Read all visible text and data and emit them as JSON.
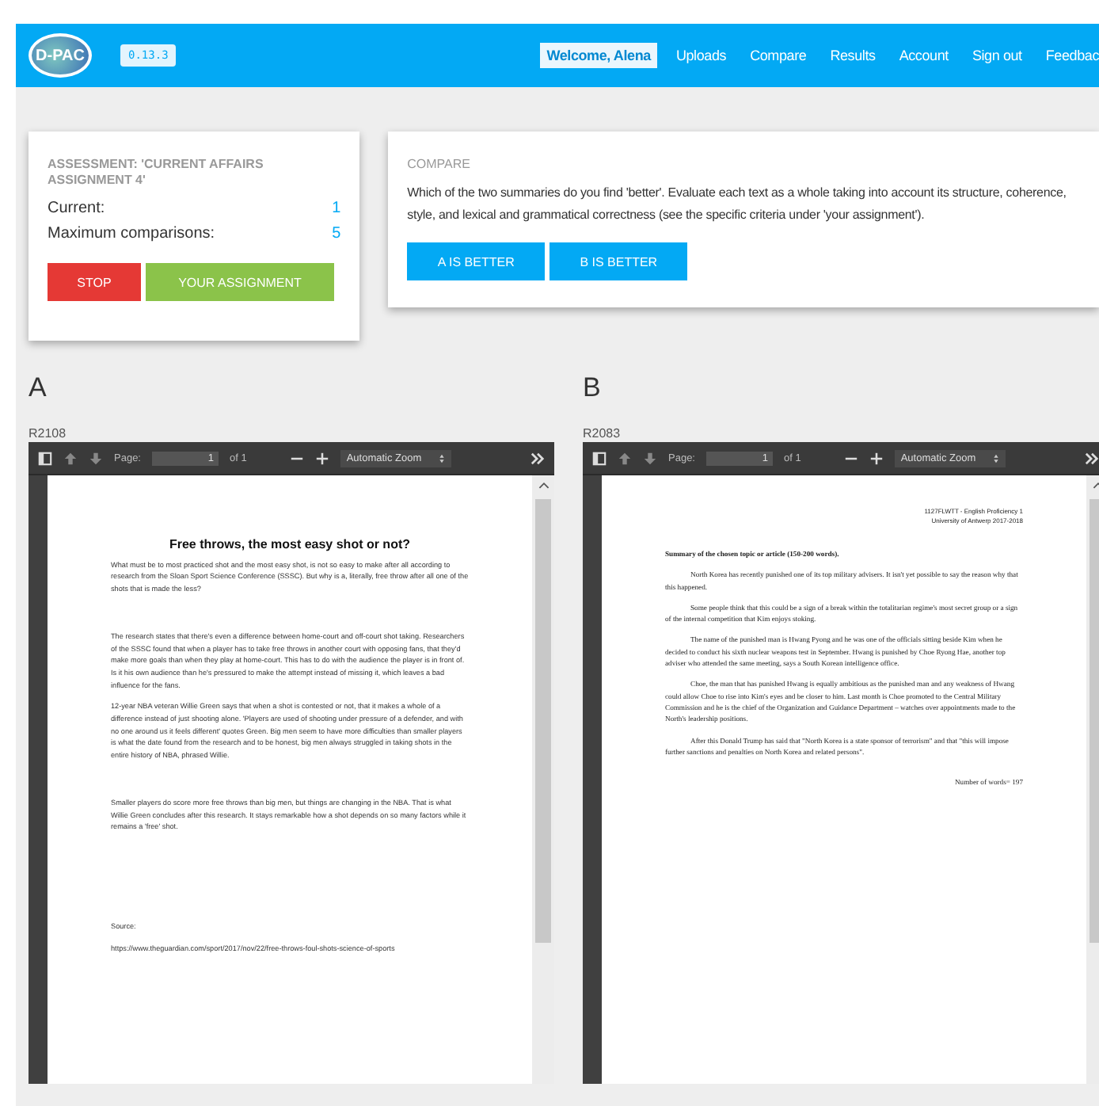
{
  "nav": {
    "logo": "D-PAC",
    "version": "0.13.3",
    "welcome": "Welcome, Alena",
    "links": [
      "Uploads",
      "Compare",
      "Results",
      "Account",
      "Sign out",
      "Feedbac"
    ]
  },
  "assessment": {
    "title": "ASSESSMENT: 'CURRENT AFFAIRS ASSIGNMENT 4'",
    "stats": [
      {
        "label": "Current:",
        "value": "1"
      },
      {
        "label": "Maximum comparisons:",
        "value": "5"
      }
    ],
    "buttons": [
      {
        "label": "STOP",
        "kind": "danger"
      },
      {
        "label": "YOUR ASSIGNMENT",
        "kind": "success"
      }
    ]
  },
  "compare": {
    "title": "COMPARE",
    "text": "Which of the two summaries do you find 'better'. Evaluate each text as a whole taking into account its structure, coherence, style, and lexical and grammatical correctness (see the specific criteria under 'your assignment').",
    "buttons": [
      "A IS BETTER",
      "B IS BETTER"
    ]
  },
  "documents": [
    {
      "letter": "A",
      "code": "R2108",
      "toolbar": {
        "page_label": "Page:",
        "page": "1",
        "of": "of 1",
        "zoom": "Automatic Zoom"
      },
      "kind": "article",
      "blocks": [
        {
          "kind": "title",
          "text": "Free throws, the most easy shot or not?"
        },
        {
          "kind": "para",
          "text": "What must be to most practiced shot and the most easy shot, is not so easy to make after all according to research from the Sloan Sport Science Conference (SSSC). But why is a, literally, free throw after all one of the shots that is made the less?"
        },
        {
          "kind": "spaced",
          "text": "The research states that there's even a difference between home-court and off-court shot taking. Researchers of the SSSC found that when a player has to take free throws in another court with opposing fans, that they'd make more goals than when they play at home-court. This has to do with the audience the player is in front of. Is it his own audience than he's pressured to make the attempt instead of missing it, which leaves a bad influence for the fans."
        },
        {
          "kind": "para",
          "text": "12-year NBA veteran Willie Green says that when a shot is contested or not, that it makes a whole of a difference instead of just shooting alone. 'Players are used of shooting under pressure of a defender, and with no one around us it feels different' quotes Green. Big men seem to have more difficulties than smaller players is what the date found from the research and to be honest, big men always struggled in taking shots in the entire history of NBA, phrased Willie."
        },
        {
          "kind": "spaced",
          "text": "Smaller players do score more free throws than big men, but things are changing in the NBA. That is what Willie Green concludes after this research. It stays remarkable how a shot depends on so many factors while it remains a 'free' shot."
        },
        {
          "kind": "source",
          "text": "Source:"
        },
        {
          "kind": "link",
          "text": "https://www.theguardian.com/sport/2017/nov/22/free-throws-foul-shots-science-of-sports"
        }
      ]
    },
    {
      "letter": "B",
      "code": "R2083",
      "toolbar": {
        "page_label": "Page:",
        "page": "1",
        "of": "of 1",
        "zoom": "Automatic Zoom"
      },
      "kind": "summary",
      "blocks": [
        {
          "kind": "header",
          "text": "1127FLWTT - English Proficiency 1"
        },
        {
          "kind": "header",
          "text": "University of Antwerp 2017-2018"
        },
        {
          "kind": "heading",
          "text": "Summary of the chosen topic or article (150-200 words)."
        },
        {
          "kind": "indent",
          "text": "North Korea has recently punished one of its top military advisers. It isn't yet possible to say the reason why that this happened."
        },
        {
          "kind": "indent",
          "text": "Some people think that this could be a sign of a break within the totalitarian regime's most secret group or a sign of the internal competition that Kim enjoys stoking."
        },
        {
          "kind": "indent",
          "text": "The name of the punished man is Hwang Pyong and he was one of the officials sitting beside Kim when he decided to conduct his sixth nuclear weapons test in September. Hwang is punished by Choe Ryong Hae, another top adviser who attended the same meeting, says a South Korean intelligence office."
        },
        {
          "kind": "indent",
          "text": "Choe, the man that has punished Hwang is equally ambitious as the punished man and any weakness of Hwang could allow Choe to rise into Kim's eyes and be closer to him. Last month is Choe promoted to the Central Military Commission and he is the chief of the Organization and Guidance Department – watches over appointments made to the North's leadership positions."
        },
        {
          "kind": "indent",
          "text": "After this Donald Trump has said that \"North Korea is a state sponsor of terrorism\" and that \"this will impose further sanctions and penalties on North Korea and related persons\"."
        },
        {
          "kind": "count",
          "text": "Number of words= 197"
        }
      ]
    }
  ]
}
